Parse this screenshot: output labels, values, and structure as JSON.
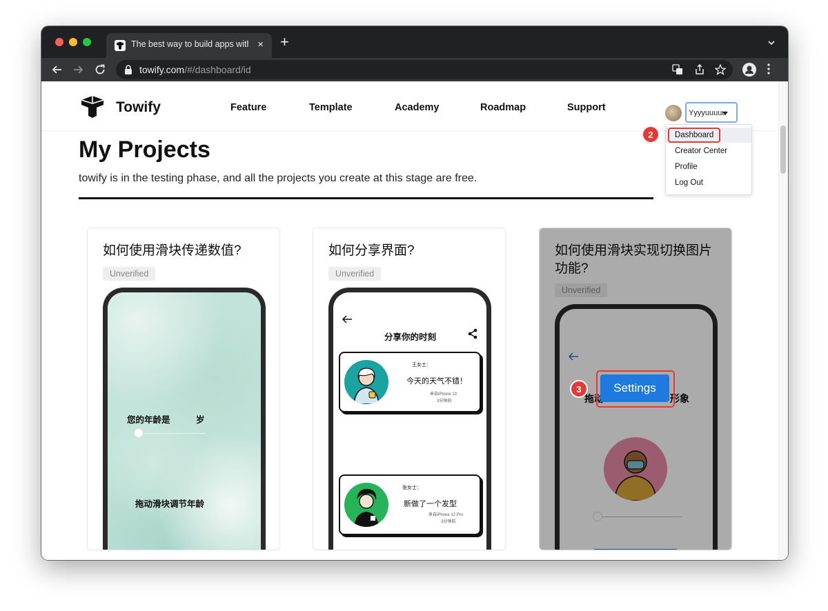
{
  "browser": {
    "tab_title": "The best way to build apps with",
    "url_host": "towify.com",
    "url_path": "/#/dashboard/id",
    "new_tab": "+",
    "tab_close": "×"
  },
  "site": {
    "brand": "Towify",
    "nav": [
      "Feature",
      "Template",
      "Academy",
      "Roadmap",
      "Support"
    ],
    "user_name": "Yyyyuuuuu",
    "menu": [
      "Dashboard",
      "Creator Center",
      "Profile",
      "Log Out"
    ]
  },
  "page": {
    "title": "My Projects",
    "subtitle": "towify is in the testing phase, and all the projects you create at this stage are free."
  },
  "projects": [
    {
      "title": "如何使用滑块传递数值?",
      "badge": "Unverified",
      "screen": {
        "age_label": "您的年龄是",
        "age_unit": "岁",
        "hint": "拖动滑块调节年龄"
      }
    },
    {
      "title": "如何分享界面?",
      "badge": "Unverified",
      "screen": {
        "header": "分享你的时刻",
        "posts": [
          {
            "name": "王女士：",
            "message": "今天的天气不错！",
            "device": "来自iPhone 13",
            "time": "3分钟前"
          },
          {
            "name": "张女士：",
            "message": "新做了一个发型",
            "device": "来自iPhone 12 Pro",
            "time": "3分钟前"
          }
        ]
      }
    },
    {
      "title": "如何使用滑块实现切换图片功能?",
      "badge": "Unverified",
      "screen": {
        "heading_left": "拖动",
        "heading_right": "形象",
        "settings_label": "Settings"
      }
    }
  ],
  "annotations": {
    "step_dashboard": "2",
    "step_settings": "3"
  },
  "colors": {
    "accent": "#1f7ae0",
    "annotation": "#e53935",
    "chrome_dark": "#202124"
  }
}
